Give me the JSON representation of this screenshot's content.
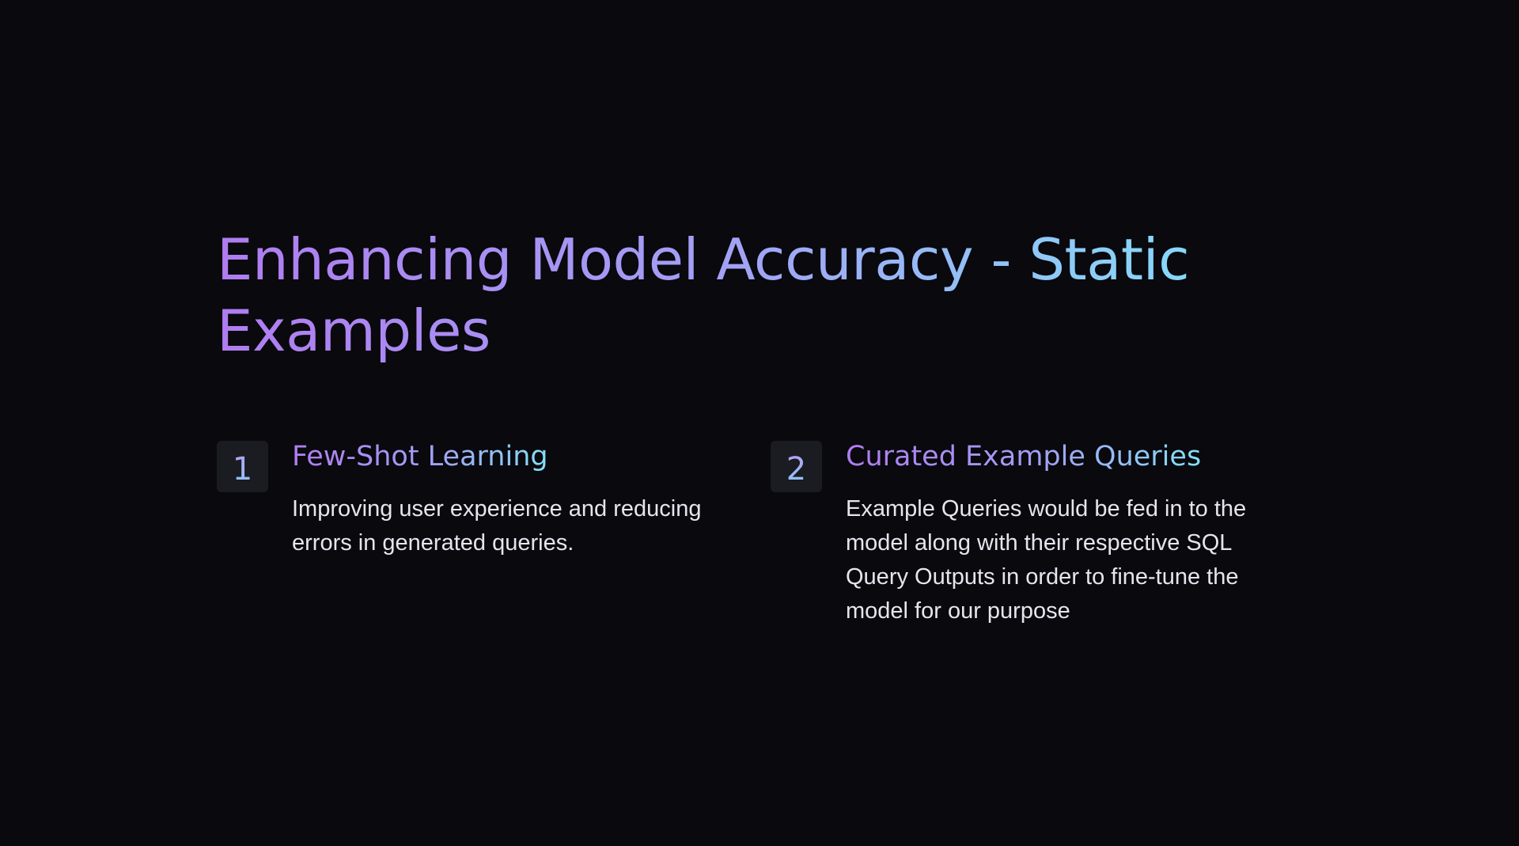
{
  "slide": {
    "title": "Enhancing Model Accuracy - Static Examples",
    "items": [
      {
        "number": "1",
        "heading": "Few-Shot Learning",
        "body": "Improving user experience and reducing errors in generated queries."
      },
      {
        "number": "2",
        "heading": "Curated Example Queries",
        "body": "Example Queries would be fed in to the model along with their respective SQL Query Outputs in order to fine-tune the model for our purpose"
      }
    ]
  },
  "colors": {
    "background": "#09090e",
    "title_gradient_start": "#b07cf0",
    "title_gradient_end": "#7ee8f8",
    "number_box": "#1b1b22",
    "body_text": "#e8e4ee"
  }
}
